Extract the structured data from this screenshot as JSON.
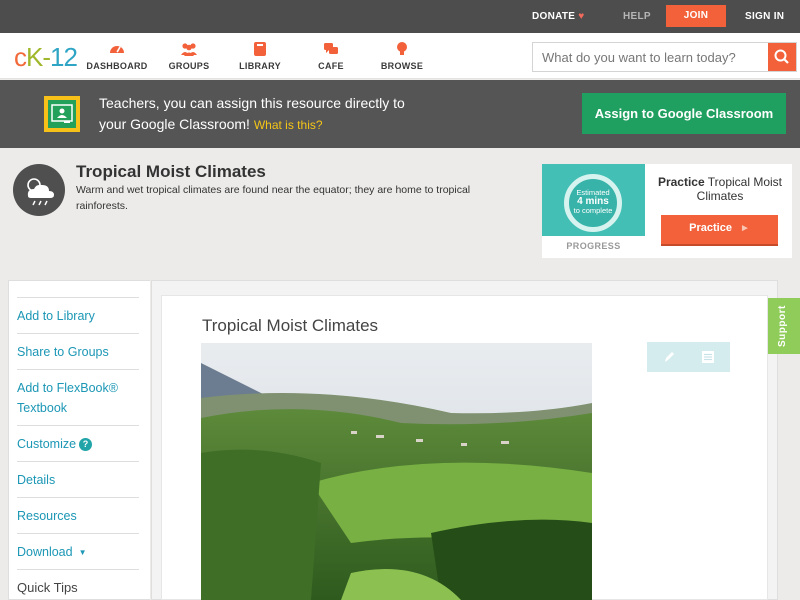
{
  "topbar": {
    "donate_label": "DONATE",
    "help_label": "HELP",
    "join_label": "JOIN",
    "signin_label": "SIGN IN"
  },
  "brand": {
    "logo_ck": "c",
    "logo_k": "K",
    "logo_dash": "-",
    "logo_num": "12"
  },
  "nav": {
    "items": [
      {
        "label": "DASHBOARD",
        "icon": "gauge-icon"
      },
      {
        "label": "GROUPS",
        "icon": "people-icon"
      },
      {
        "label": "LIBRARY",
        "icon": "book-icon"
      },
      {
        "label": "CAFE",
        "icon": "chat-bubbles-icon"
      },
      {
        "label": "BROWSE",
        "icon": "lightbulb-icon"
      }
    ]
  },
  "search": {
    "placeholder": "What do you want to learn today?",
    "value": ""
  },
  "classroom_banner": {
    "line1": "Teachers, you can assign this resource directly to",
    "line2": "your Google Classroom!",
    "what_link": "What is this?",
    "button_label": "Assign to Google Classroom"
  },
  "concept": {
    "title": "Tropical Moist Climates",
    "description": "Warm and wet tropical climates are found near the equator; they are home to tropical rainforests.",
    "icon": "cloud-rain-icon"
  },
  "practice": {
    "estimate_line1": "Estimated",
    "estimate_mins": "4 mins",
    "estimate_line3": "to complete",
    "progress_label": "PROGRESS",
    "title_bold": "Practice",
    "title_rest": "Tropical Moist Climates",
    "button_label": "Practice"
  },
  "sidebar": {
    "items": [
      {
        "label": "Add to Library"
      },
      {
        "label": "Share to Groups"
      },
      {
        "label": "Add to FlexBook® Textbook"
      },
      {
        "label": "Customize"
      },
      {
        "label": "Details"
      },
      {
        "label": "Resources"
      },
      {
        "label": "Download"
      }
    ],
    "customize_help": "?",
    "quick_tips": "Quick Tips"
  },
  "article": {
    "title": "Tropical Moist Climates"
  },
  "support": {
    "label": "Support"
  },
  "colors": {
    "accent_orange": "#f2613a",
    "classroom_green": "#20a060",
    "link_blue": "#1c97b5",
    "support_green": "#8fcc5a"
  }
}
